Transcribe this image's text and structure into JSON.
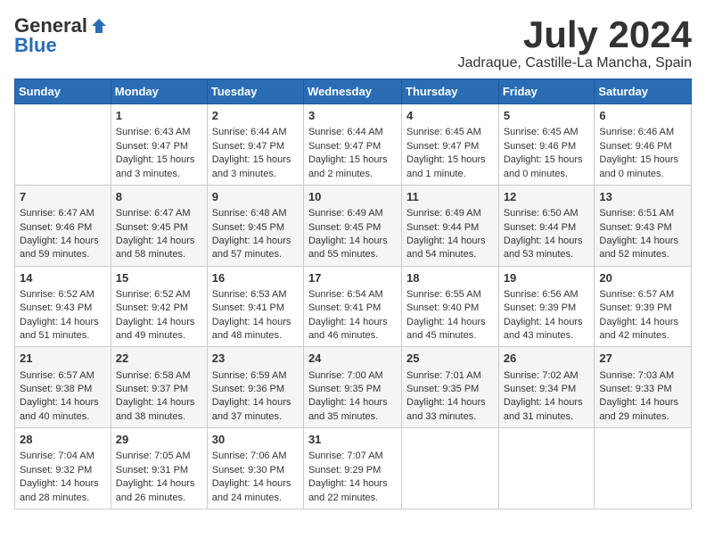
{
  "logo": {
    "general": "General",
    "blue": "Blue"
  },
  "title": {
    "month_year": "July 2024",
    "location": "Jadraque, Castille-La Mancha, Spain"
  },
  "days_of_week": [
    "Sunday",
    "Monday",
    "Tuesday",
    "Wednesday",
    "Thursday",
    "Friday",
    "Saturday"
  ],
  "weeks": [
    [
      {
        "day": "",
        "content": ""
      },
      {
        "day": "1",
        "content": "Sunrise: 6:43 AM\nSunset: 9:47 PM\nDaylight: 15 hours\nand 3 minutes."
      },
      {
        "day": "2",
        "content": "Sunrise: 6:44 AM\nSunset: 9:47 PM\nDaylight: 15 hours\nand 3 minutes."
      },
      {
        "day": "3",
        "content": "Sunrise: 6:44 AM\nSunset: 9:47 PM\nDaylight: 15 hours\nand 2 minutes."
      },
      {
        "day": "4",
        "content": "Sunrise: 6:45 AM\nSunset: 9:47 PM\nDaylight: 15 hours\nand 1 minute."
      },
      {
        "day": "5",
        "content": "Sunrise: 6:45 AM\nSunset: 9:46 PM\nDaylight: 15 hours\nand 0 minutes."
      },
      {
        "day": "6",
        "content": "Sunrise: 6:46 AM\nSunset: 9:46 PM\nDaylight: 15 hours\nand 0 minutes."
      }
    ],
    [
      {
        "day": "7",
        "content": "Sunrise: 6:47 AM\nSunset: 9:46 PM\nDaylight: 14 hours\nand 59 minutes."
      },
      {
        "day": "8",
        "content": "Sunrise: 6:47 AM\nSunset: 9:45 PM\nDaylight: 14 hours\nand 58 minutes."
      },
      {
        "day": "9",
        "content": "Sunrise: 6:48 AM\nSunset: 9:45 PM\nDaylight: 14 hours\nand 57 minutes."
      },
      {
        "day": "10",
        "content": "Sunrise: 6:49 AM\nSunset: 9:45 PM\nDaylight: 14 hours\nand 55 minutes."
      },
      {
        "day": "11",
        "content": "Sunrise: 6:49 AM\nSunset: 9:44 PM\nDaylight: 14 hours\nand 54 minutes."
      },
      {
        "day": "12",
        "content": "Sunrise: 6:50 AM\nSunset: 9:44 PM\nDaylight: 14 hours\nand 53 minutes."
      },
      {
        "day": "13",
        "content": "Sunrise: 6:51 AM\nSunset: 9:43 PM\nDaylight: 14 hours\nand 52 minutes."
      }
    ],
    [
      {
        "day": "14",
        "content": "Sunrise: 6:52 AM\nSunset: 9:43 PM\nDaylight: 14 hours\nand 51 minutes."
      },
      {
        "day": "15",
        "content": "Sunrise: 6:52 AM\nSunset: 9:42 PM\nDaylight: 14 hours\nand 49 minutes."
      },
      {
        "day": "16",
        "content": "Sunrise: 6:53 AM\nSunset: 9:41 PM\nDaylight: 14 hours\nand 48 minutes."
      },
      {
        "day": "17",
        "content": "Sunrise: 6:54 AM\nSunset: 9:41 PM\nDaylight: 14 hours\nand 46 minutes."
      },
      {
        "day": "18",
        "content": "Sunrise: 6:55 AM\nSunset: 9:40 PM\nDaylight: 14 hours\nand 45 minutes."
      },
      {
        "day": "19",
        "content": "Sunrise: 6:56 AM\nSunset: 9:39 PM\nDaylight: 14 hours\nand 43 minutes."
      },
      {
        "day": "20",
        "content": "Sunrise: 6:57 AM\nSunset: 9:39 PM\nDaylight: 14 hours\nand 42 minutes."
      }
    ],
    [
      {
        "day": "21",
        "content": "Sunrise: 6:57 AM\nSunset: 9:38 PM\nDaylight: 14 hours\nand 40 minutes."
      },
      {
        "day": "22",
        "content": "Sunrise: 6:58 AM\nSunset: 9:37 PM\nDaylight: 14 hours\nand 38 minutes."
      },
      {
        "day": "23",
        "content": "Sunrise: 6:59 AM\nSunset: 9:36 PM\nDaylight: 14 hours\nand 37 minutes."
      },
      {
        "day": "24",
        "content": "Sunrise: 7:00 AM\nSunset: 9:35 PM\nDaylight: 14 hours\nand 35 minutes."
      },
      {
        "day": "25",
        "content": "Sunrise: 7:01 AM\nSunset: 9:35 PM\nDaylight: 14 hours\nand 33 minutes."
      },
      {
        "day": "26",
        "content": "Sunrise: 7:02 AM\nSunset: 9:34 PM\nDaylight: 14 hours\nand 31 minutes."
      },
      {
        "day": "27",
        "content": "Sunrise: 7:03 AM\nSunset: 9:33 PM\nDaylight: 14 hours\nand 29 minutes."
      }
    ],
    [
      {
        "day": "28",
        "content": "Sunrise: 7:04 AM\nSunset: 9:32 PM\nDaylight: 14 hours\nand 28 minutes."
      },
      {
        "day": "29",
        "content": "Sunrise: 7:05 AM\nSunset: 9:31 PM\nDaylight: 14 hours\nand 26 minutes."
      },
      {
        "day": "30",
        "content": "Sunrise: 7:06 AM\nSunset: 9:30 PM\nDaylight: 14 hours\nand 24 minutes."
      },
      {
        "day": "31",
        "content": "Sunrise: 7:07 AM\nSunset: 9:29 PM\nDaylight: 14 hours\nand 22 minutes."
      },
      {
        "day": "",
        "content": ""
      },
      {
        "day": "",
        "content": ""
      },
      {
        "day": "",
        "content": ""
      }
    ]
  ]
}
